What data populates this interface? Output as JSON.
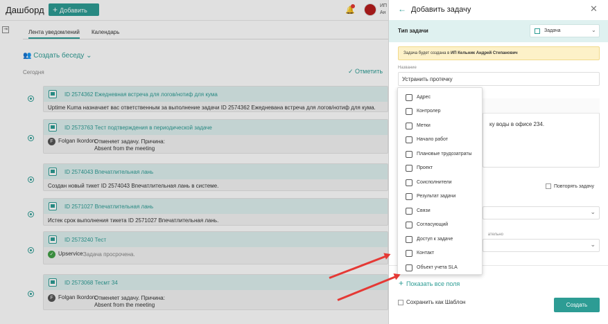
{
  "header": {
    "title": "Дашборд",
    "add_label": "Добавить",
    "user_line1": "ИП",
    "user_line2": "Ан"
  },
  "tabs": [
    "Лента уведомлений",
    "Календарь"
  ],
  "chat_label": "Создать беседу",
  "today_label": "Сегодня",
  "mark_label": "Отметить",
  "feed": [
    {
      "title": "ID 2574362 Ежедневная встреча для логов/нотиф для кума",
      "body": "Uptime Kuma назначает вас ответственным за выполнение задачи ID 2574362 Ежедневана встреча для логов/нотиф для кума."
    },
    {
      "title": "ID 2573763 Тест подтверждения в периодической задаче",
      "author": "Folgan Ikordon:",
      "line1": "Отменяет задачу. Причина:",
      "line2": "Absent from the meeting"
    },
    {
      "title": "ID 2574043 Впечатлительная лань",
      "body": "Создан новый тикет ID 2574043 Впечатлительная лань в системе."
    },
    {
      "title": "ID 2571027 Впечатлительная лань",
      "body": "Истек срок выполнения тикета ID 2571027 Впечатлительная лань."
    },
    {
      "title": "ID 2573240 Тест",
      "author": "Upservice:",
      "line1": "Задача просрочена."
    },
    {
      "title": "ID 2573068 Тесмт 34",
      "author": "Folgan Ikordon:",
      "line1": "Отменяет задачу. Причина:",
      "line2": "Absent from the meeting"
    }
  ],
  "panel": {
    "title": "Добавить задачу",
    "type_label": "Тип задачи",
    "type_value": "Задача",
    "notice_prefix": "Задача будет создана в",
    "notice_bold": "ИП Кельник Андрей Степанович",
    "name_label": "Название",
    "name_value": "Устранить протечку",
    "desc_text": "ку воды в офисе 234.",
    "repeat_label": "Повторять задачу",
    "sel2_label": "ательно",
    "show_all": "Показать все поля",
    "template_label": "Сохранить как Шаблон",
    "create_label": "Создать"
  },
  "dropdown": [
    "Адрес",
    "Контролер",
    "Метки",
    "Начало работ",
    "Плановые трудозатраты",
    "Проект",
    "Соисполнители",
    "Результат задачи",
    "Связи",
    "Согласующий",
    "Доступ к задаче",
    "Контакт",
    "Объект учета SLA"
  ],
  "colors": {
    "accent": "#2d9c94",
    "arrow": "#e53935",
    "notice": "#fdf1c8"
  }
}
